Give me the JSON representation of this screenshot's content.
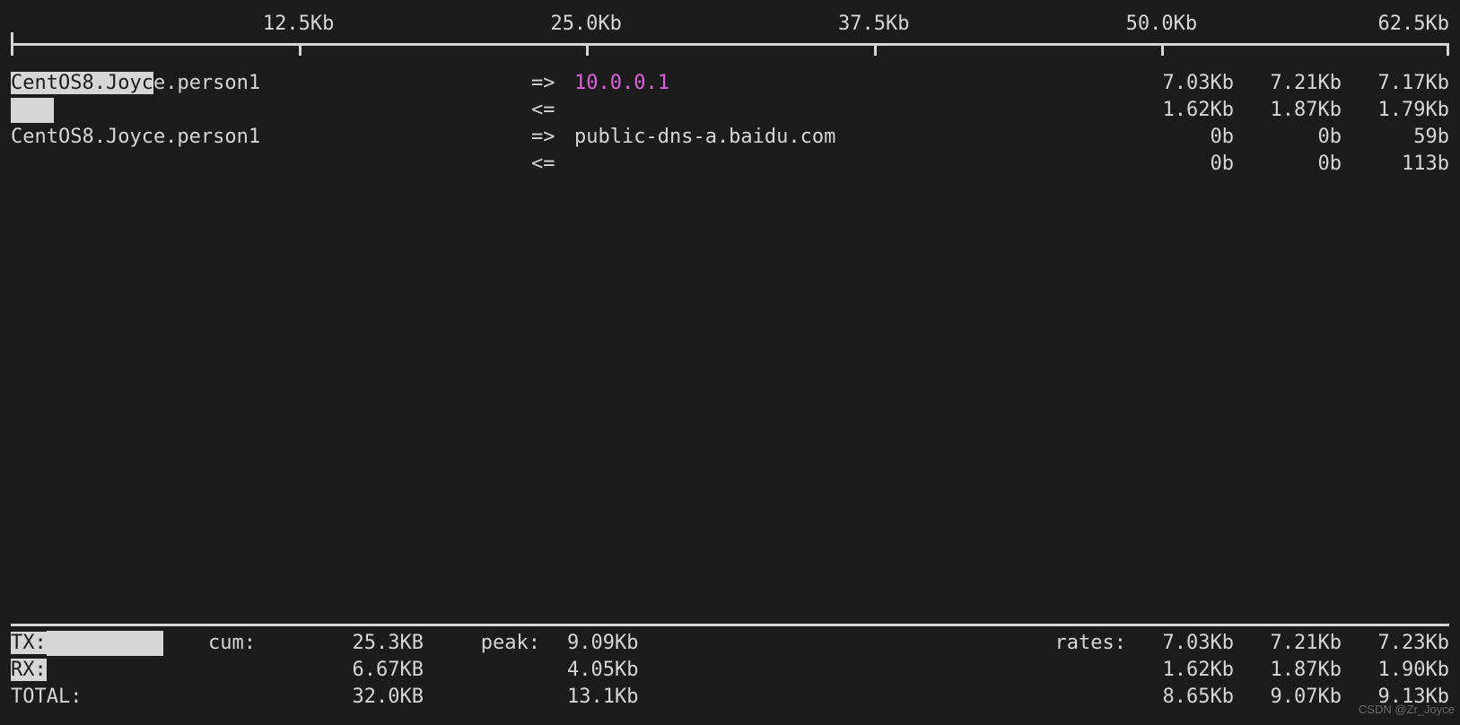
{
  "scale": {
    "ticks": [
      "12.5Kb",
      "25.0Kb",
      "37.5Kb",
      "50.0Kb",
      "62.5Kb"
    ]
  },
  "connections": [
    {
      "local": "CentOS8.Joyce.person1",
      "local_highlight_prefix": "CentOS8.Joyc",
      "local_highlight_rest": "e.person1",
      "remote": "10.0.0.1",
      "remote_highlight": true,
      "tx": {
        "arrow": "=>",
        "r2s": "7.03Kb",
        "r10s": "7.21Kb",
        "r40s": "7.17Kb"
      },
      "rx": {
        "arrow": "<=",
        "r2s": "1.62Kb",
        "r10s": "1.87Kb",
        "r40s": "1.79Kb"
      },
      "bar_tx": true
    },
    {
      "local": "CentOS8.Joyce.person1",
      "remote": "public-dns-a.baidu.com",
      "remote_highlight": false,
      "tx": {
        "arrow": "=>",
        "r2s": "0b",
        "r10s": "0b",
        "r40s": "59b"
      },
      "rx": {
        "arrow": "<=",
        "r2s": "0b",
        "r10s": "0b",
        "r40s": "113b"
      }
    }
  ],
  "footer": {
    "tx_label": "TX:",
    "rx_label": "RX:",
    "total_label": "TOTAL:",
    "cum_label": "cum:",
    "peak_label": "peak:",
    "rates_label": "rates:",
    "tx": {
      "cum": "25.3KB",
      "peak": "9.09Kb",
      "r2s": "7.03Kb",
      "r10s": "7.21Kb",
      "r40s": "7.23Kb"
    },
    "rx": {
      "cum": "6.67KB",
      "peak": "4.05Kb",
      "r2s": "1.62Kb",
      "r10s": "1.87Kb",
      "r40s": "1.90Kb"
    },
    "total": {
      "cum": "32.0KB",
      "peak": "13.1Kb",
      "r2s": "8.65Kb",
      "r10s": "9.07Kb",
      "r40s": "9.13Kb"
    }
  },
  "watermark": "CSDN @Zr_Joyce"
}
